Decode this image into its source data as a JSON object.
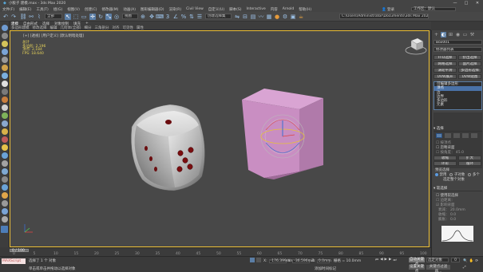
{
  "window": {
    "title": "小骰子 建模.max - 3ds Max 2020",
    "controls": [
      "—",
      "□",
      "✕"
    ]
  },
  "menu": {
    "items": [
      "文件(F)",
      "编辑(E)",
      "工具(T)",
      "组(G)",
      "视图(V)",
      "创建(C)",
      "修改器(M)",
      "动画(A)",
      "图形编辑器(D)",
      "渲染(R)",
      "Civil View",
      "自定义(U)",
      "脚本(S)",
      "Interactive",
      "内容",
      "Arnold",
      "帮助(H)"
    ],
    "user": "登录",
    "workspace_label": "工作区：",
    "workspace_value": "默认"
  },
  "toolbar": {
    "undo": "↶",
    "redo": "↷",
    "link": "⛓",
    "unlink": "⚯",
    "bind": "⌇",
    "filter_combo": "全部",
    "select": "↖",
    "select_region": "⬚",
    "rotate_icon": "↻",
    "scale": "⤡",
    "coord_combo": "视图",
    "pivot": "⊕",
    "select_manip": "✥",
    "snap3": "3",
    "angle_snap": "∠",
    "percent_snap": "%",
    "spinner_snap": "⇅",
    "named_sel_combo": "创建选择集",
    "mirror": "⇋",
    "align": "⊟",
    "layers": "▤",
    "curve": "〰",
    "schematic": "▦",
    "material": "●",
    "render_setup": "⚙",
    "render": "▣",
    "path_combo": "C:\\Users\\Administrator\\Documents\\3ds Max 2020"
  },
  "ribbon": {
    "tabs": [
      "建模",
      "自由形式",
      "选择",
      "对象绘制",
      "填充",
      "+"
    ],
    "sub": [
      "多边形建模",
      "修改选择",
      "编辑",
      "几何体(全部)",
      "细分",
      "三角剖分",
      "对齐",
      "可见性",
      "属性"
    ]
  },
  "viewport": {
    "label": "[+] [透视] [用户定义] [默认明暗处理]",
    "stats": [
      "总计",
      "多边形: 2,196",
      "顶点: 2,184",
      "",
      "FPS:  18.640"
    ]
  },
  "cmdpanel": {
    "object_name": "Box001",
    "modifier_list": "修改器列表",
    "buttons": [
      "FFD选择",
      "挤出选择",
      "网格选择",
      "面片选择",
      "涡轮平滑",
      "多边形选择",
      "UVW展开",
      "UVW贴图"
    ],
    "stack": [
      "可编辑多边形",
      "顶点",
      "边",
      "边界",
      "多边形",
      "元素"
    ],
    "selection_title": "选择",
    "by_vertex": "按顶点",
    "ignore_backfacing": "忽略背面",
    "by_angle": "按角度：",
    "angle_value": "45.0",
    "shrink": "收缩",
    "grow": "扩大",
    "ring": "环形",
    "loop": "循环",
    "preview_title": "预览选择",
    "preview_opts": [
      "禁用",
      "子对象",
      "多个"
    ],
    "status": "选定整个对象",
    "softsel_title": "软选择",
    "use_softsel": "使用软选择",
    "edge_dist": "边距离：",
    "affect_back": "影响背面",
    "falloff": "衰减：",
    "falloff_val": "20.0mm",
    "pinch": "收缩：",
    "pinch_val": "0.0",
    "bubble": "膨胀：",
    "bubble_val": "0.0"
  },
  "timeline": {
    "frame_counter": "0 / 100",
    "ticks": [
      "0",
      "5",
      "10",
      "15",
      "20",
      "25",
      "30",
      "35",
      "40",
      "45",
      "50",
      "55",
      "60",
      "65",
      "70",
      "75",
      "80",
      "85",
      "90",
      "95",
      "100"
    ]
  },
  "status": {
    "script_label": "MAXScript 迷",
    "selection": "选择了 1 个 对象",
    "hint": "单击或单击并拖动以选择对象",
    "x_label": "X:",
    "x_val": "-176.399mm",
    "y_label": "Y:",
    "y_val": "-36.596mm",
    "z_label": "Z:",
    "z_val": "0.0mm",
    "grid": "栅格 = 10.0mm",
    "autokey": "自动关键点",
    "selected_combo": "选定对象",
    "setkey": "设置关键点",
    "keyfilter": "关键点过滤器...",
    "add_time_tag": "添加时间标记",
    "frame": "0"
  },
  "colors": {
    "accent": "#5b7ea6",
    "viewport_border": "#f0c23a",
    "box_fill": "#c98ec2",
    "dice_pip": "#7a0e10"
  }
}
